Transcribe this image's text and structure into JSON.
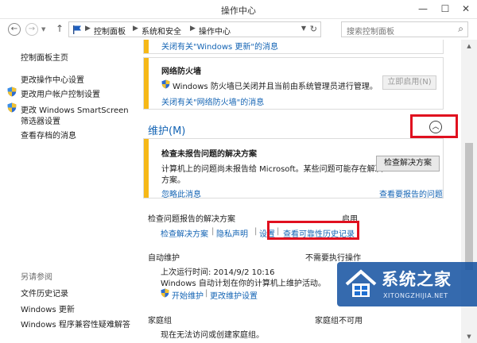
{
  "window": {
    "title": "操作中心",
    "minimize": "—",
    "maximize": "☐",
    "close": "✕"
  },
  "nav": {
    "back": "←",
    "forward": "→",
    "up": "↑",
    "breadcrumb": [
      "控制面板",
      "系统和安全",
      "操作中心"
    ],
    "breadcrumb_sep": "▶",
    "search_placeholder": "搜索控制面板"
  },
  "sidebar": {
    "home": "控制面板主页",
    "items": [
      "更改操作中心设置",
      "更改用户帐户控制设置",
      "更改 Windows SmartScreen",
      "筛选器设置",
      "查看存档的消息"
    ],
    "see_also_title": "另请参阅",
    "see_also": [
      "文件历史记录",
      "Windows 更新",
      "Windows 程序兼容性疑难解答"
    ]
  },
  "security": {
    "update_link": "关闭有关\"Windows 更新\"的消息",
    "firewall_title": "网络防火墙",
    "firewall_message": "Windows 防火墙已关闭并且当前由系统管理员进行管理。",
    "firewall_button": "立即启用(N)",
    "firewall_link": "关闭有关\"网络防火墙\"的消息"
  },
  "maintenance": {
    "title": "维护(M)",
    "collapse_icon": "︿",
    "card_title": "检查未报告问题的解决方案",
    "card_message_1": "计算机上的问题尚未报告给 Microsoft。某些问题可能存在解决",
    "card_message_2": "方案。",
    "card_button": "检查解决方案",
    "ignore_link": "忽略此消息",
    "view_link": "查看要报告的问题",
    "report_label": "检查问题报告的解决方案",
    "report_status": "启用",
    "report_links": [
      "检查解决方案",
      "隐私声明",
      "设置",
      "查看可靠性历史记录"
    ],
    "link_sep": "|",
    "auto_label": "自动维护",
    "auto_status": "不需要执行操作",
    "last_run": "上次运行时间: 2014/9/2 10:16",
    "auto_desc": "Windows 自动计划在你的计算机上维护活动。",
    "start_link": "开始维护",
    "change_link": "更改维护设置",
    "homegroup_label": "家庭组",
    "homegroup_status": "家庭组不可用",
    "homegroup_desc": "现在无法访问或创建家庭组。"
  },
  "watermark": {
    "text": "系统之家",
    "url": "XITONGZHIJIA.NET"
  },
  "scrollbar": {
    "up": "▲",
    "down": "▼"
  }
}
